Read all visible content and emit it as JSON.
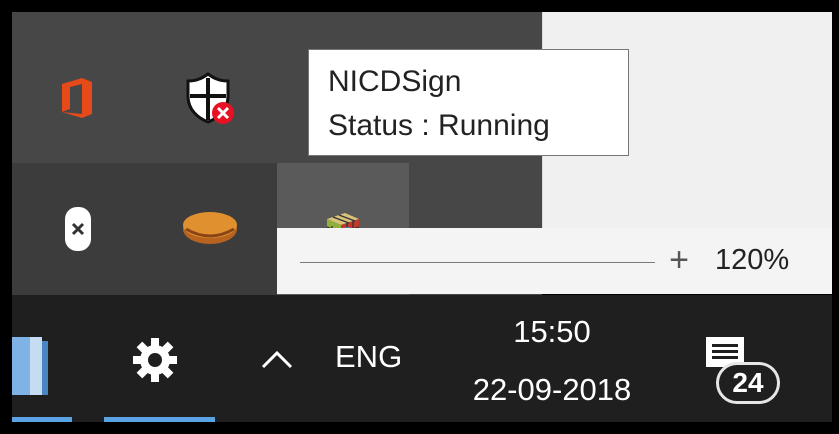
{
  "tooltip": {
    "app_name": "NICDSign",
    "status": "Status : Running"
  },
  "tray_icons": [
    {
      "name": "office-icon",
      "color": "#e64a19"
    },
    {
      "name": "security-shield-alert-icon",
      "color": "#e81123"
    },
    {
      "name": "close-x-icon",
      "color": "#ffffff"
    },
    {
      "name": "orange-disc-icon",
      "color": "#d2691e"
    },
    {
      "name": "rubiks-cube-icon",
      "color": "#8fb03a"
    }
  ],
  "status_bar": {
    "zoom_plus": "+",
    "zoom_level": "120%"
  },
  "taskbar": {
    "show_hidden_icons": "^",
    "language": "ENG",
    "time": "15:50",
    "date": "22-09-2018",
    "notification_count": "24",
    "accent_color": "#5aa4e6"
  }
}
